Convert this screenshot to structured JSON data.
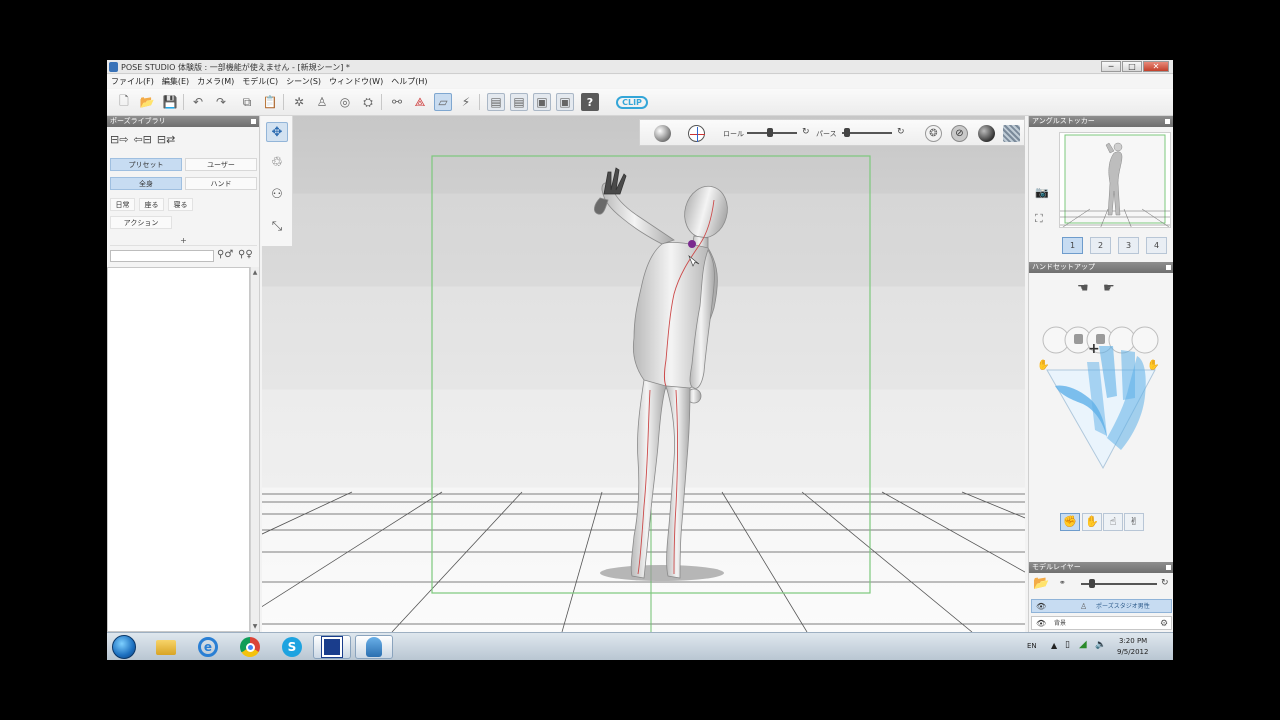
{
  "window": {
    "title": "POSE STUDIO 体験版 : 一部機能が使えません - [新規シーン] *",
    "controls": {
      "minimize": "─",
      "maximize": "□",
      "close": "✕"
    }
  },
  "menu": [
    "ファイル(F)",
    "編集(E)",
    "カメラ(M)",
    "モデル(C)",
    "シーン(S)",
    "ウィンドウ(W)",
    "ヘルプ(H)"
  ],
  "toolbar": {
    "help_label": "?",
    "logo_text": "CLIP"
  },
  "pose_library": {
    "header": "ポーズライブラリ",
    "tabs": [
      {
        "label": "プリセット",
        "selected": true
      },
      {
        "label": "ユーザー",
        "selected": false
      }
    ],
    "scope": [
      {
        "label": "全身",
        "selected": true
      },
      {
        "label": "ハンド",
        "selected": false
      }
    ],
    "categories": [
      "日常",
      "座る",
      "寝る",
      "アクション"
    ],
    "add_label": "+"
  },
  "view_bar": {
    "roll_label": "ロール",
    "perspective_label": "パース",
    "roll_value": 0.45,
    "perspective_value": 0.0
  },
  "angle_stocker": {
    "header": "アングルストッカー",
    "slots": [
      "1",
      "2",
      "3",
      "4"
    ],
    "selected_slot": "1"
  },
  "hand_setup": {
    "header": "ハンドセットアップ",
    "add_label": "+"
  },
  "model_layer": {
    "header": "モデルレイヤー",
    "rows": [
      {
        "label": "ポーズスタジオ男性",
        "selected": true
      },
      {
        "label": "背景",
        "selected": false
      }
    ]
  },
  "taskbar": {
    "language": "EN",
    "time": "3:20 PM",
    "date": "9/5/2012"
  },
  "colors": {
    "accent": "#c7dcf2",
    "frame_guide": "#7cc87c",
    "clip_logo": "#34a6d8",
    "hand_blue": "#5fb0e8"
  }
}
